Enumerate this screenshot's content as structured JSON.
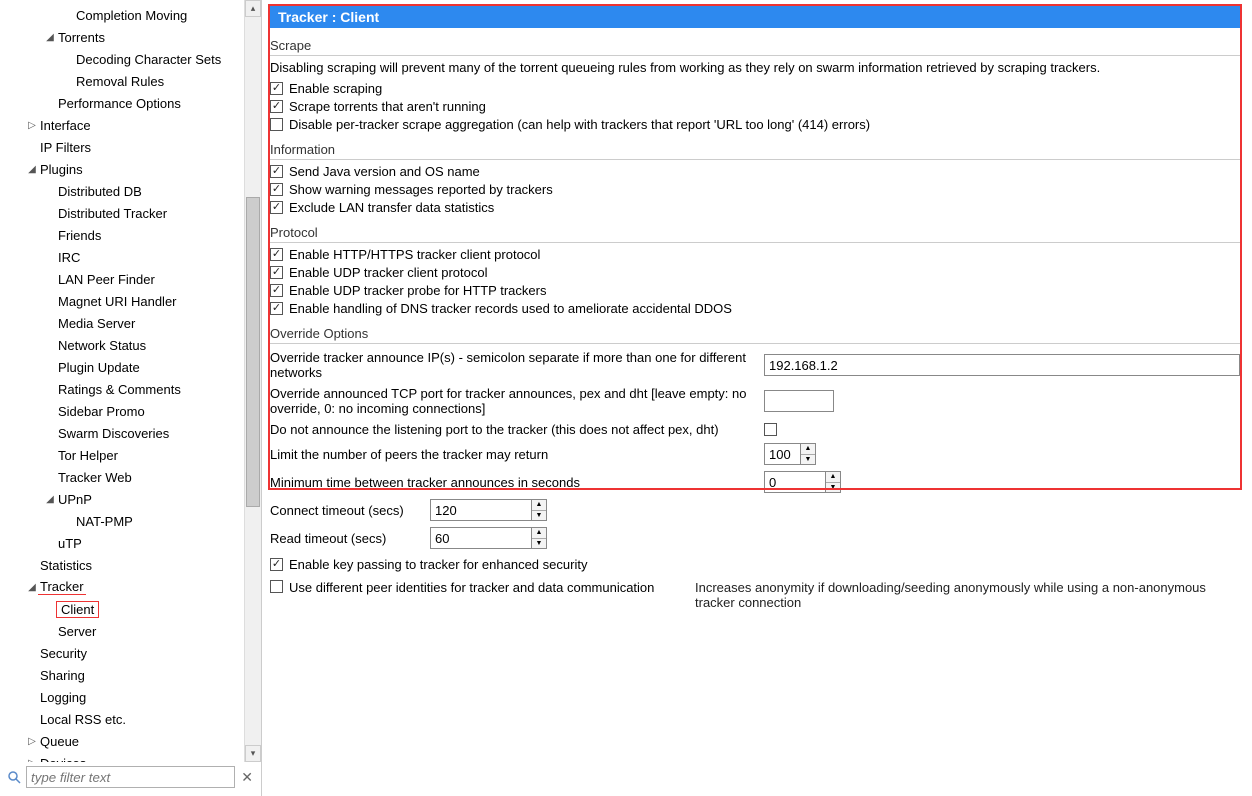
{
  "sidebar": {
    "items": [
      {
        "label": "Completion Moving",
        "indent": 3,
        "twist": ""
      },
      {
        "label": "Torrents",
        "indent": 2,
        "twist": "◢"
      },
      {
        "label": "Decoding Character Sets",
        "indent": 3,
        "twist": ""
      },
      {
        "label": "Removal Rules",
        "indent": 3,
        "twist": ""
      },
      {
        "label": "Performance Options",
        "indent": 2,
        "twist": ""
      },
      {
        "label": "Interface",
        "indent": 1,
        "twist": "▷"
      },
      {
        "label": "IP Filters",
        "indent": 1,
        "twist": ""
      },
      {
        "label": "Plugins",
        "indent": 1,
        "twist": "◢"
      },
      {
        "label": "Distributed DB",
        "indent": 2,
        "twist": ""
      },
      {
        "label": "Distributed Tracker",
        "indent": 2,
        "twist": ""
      },
      {
        "label": "Friends",
        "indent": 2,
        "twist": ""
      },
      {
        "label": "IRC",
        "indent": 2,
        "twist": ""
      },
      {
        "label": "LAN Peer Finder",
        "indent": 2,
        "twist": ""
      },
      {
        "label": "Magnet URI Handler",
        "indent": 2,
        "twist": ""
      },
      {
        "label": "Media Server",
        "indent": 2,
        "twist": ""
      },
      {
        "label": "Network Status",
        "indent": 2,
        "twist": ""
      },
      {
        "label": "Plugin Update",
        "indent": 2,
        "twist": ""
      },
      {
        "label": "Ratings & Comments",
        "indent": 2,
        "twist": ""
      },
      {
        "label": "Sidebar Promo",
        "indent": 2,
        "twist": ""
      },
      {
        "label": "Swarm Discoveries",
        "indent": 2,
        "twist": ""
      },
      {
        "label": "Tor Helper",
        "indent": 2,
        "twist": ""
      },
      {
        "label": "Tracker Web",
        "indent": 2,
        "twist": ""
      },
      {
        "label": "UPnP",
        "indent": 2,
        "twist": "◢"
      },
      {
        "label": "NAT-PMP",
        "indent": 3,
        "twist": ""
      },
      {
        "label": "uTP",
        "indent": 2,
        "twist": ""
      },
      {
        "label": "Statistics",
        "indent": 1,
        "twist": ""
      },
      {
        "label": "Tracker",
        "indent": 1,
        "twist": "◢",
        "redline": true
      },
      {
        "label": "Client",
        "indent": 2,
        "twist": "",
        "highlighted": true
      },
      {
        "label": "Server",
        "indent": 2,
        "twist": ""
      },
      {
        "label": "Security",
        "indent": 1,
        "twist": ""
      },
      {
        "label": "Sharing",
        "indent": 1,
        "twist": ""
      },
      {
        "label": "Logging",
        "indent": 1,
        "twist": ""
      },
      {
        "label": "Local RSS etc.",
        "indent": 1,
        "twist": ""
      },
      {
        "label": "Queue",
        "indent": 1,
        "twist": "▷"
      },
      {
        "label": "Devices",
        "indent": 1,
        "twist": "▷"
      }
    ],
    "search_placeholder": "type filter text"
  },
  "main": {
    "title": "Tracker : Client",
    "scrape": {
      "heading": "Scrape",
      "desc": "Disabling scraping will prevent many of the torrent queueing rules from working as they rely on swarm information retrieved by scraping trackers.",
      "cb1": "Enable scraping",
      "cb2": "Scrape torrents that aren't running",
      "cb3": "Disable per-tracker scrape aggregation (can help with trackers that report 'URL too long' (414) errors)"
    },
    "information": {
      "heading": "Information",
      "cb1": "Send Java version and OS name",
      "cb2": "Show warning messages reported by trackers",
      "cb3": "Exclude LAN transfer data statistics"
    },
    "protocol": {
      "heading": "Protocol",
      "cb1": "Enable HTTP/HTTPS tracker client protocol",
      "cb2": "Enable UDP tracker client protocol",
      "cb3": "Enable UDP tracker probe for HTTP trackers",
      "cb4": "Enable handling of DNS tracker records used to ameliorate accidental DDOS"
    },
    "override": {
      "heading": "Override Options",
      "ip_label": "Override tracker announce IP(s) - semicolon separate if more than one for different networks",
      "ip_value": "192.168.1.2",
      "port_label": "Override announced TCP port for tracker announces, pex and dht [leave empty: no override, 0: no incoming connections]",
      "port_value": "",
      "noannounce_label": "Do not announce the listening port to the tracker (this does not affect pex, dht)",
      "peers_label": "Limit the number of peers the tracker may return",
      "peers_value": "100",
      "mintime_label": "Minimum time between tracker announces in seconds",
      "mintime_value": "0"
    },
    "connect": {
      "label": "Connect timeout (secs)",
      "value": "120"
    },
    "read": {
      "label": "Read timeout (secs)",
      "value": "60"
    },
    "keypass": "Enable key passing to tracker for enhanced security",
    "diffpeer": "Use different peer identities for tracker and data communication",
    "diffpeer_note": "Increases anonymity if downloading/seeding anonymously while using a non-anonymous tracker connection"
  }
}
